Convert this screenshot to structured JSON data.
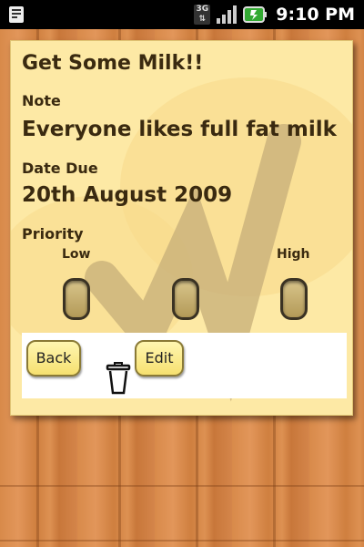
{
  "status_bar": {
    "network_label": "3G",
    "time": "9:10 PM",
    "icons": [
      "notification-icon",
      "network-3g-icon",
      "signal-icon",
      "battery-icon"
    ]
  },
  "note": {
    "title": "Get Some Milk!!",
    "note_label": "Note",
    "note_value": "Everyone likes full fat milk",
    "date_label": "Date Due",
    "date_value": "20th August 2009",
    "priority_label": "Priority",
    "priority_low": "Low",
    "priority_high": "High",
    "background_color": "#fde9a5"
  },
  "actions": {
    "back_label": "Back",
    "edit_label": "Edit",
    "delete_icon": "trash-icon"
  }
}
